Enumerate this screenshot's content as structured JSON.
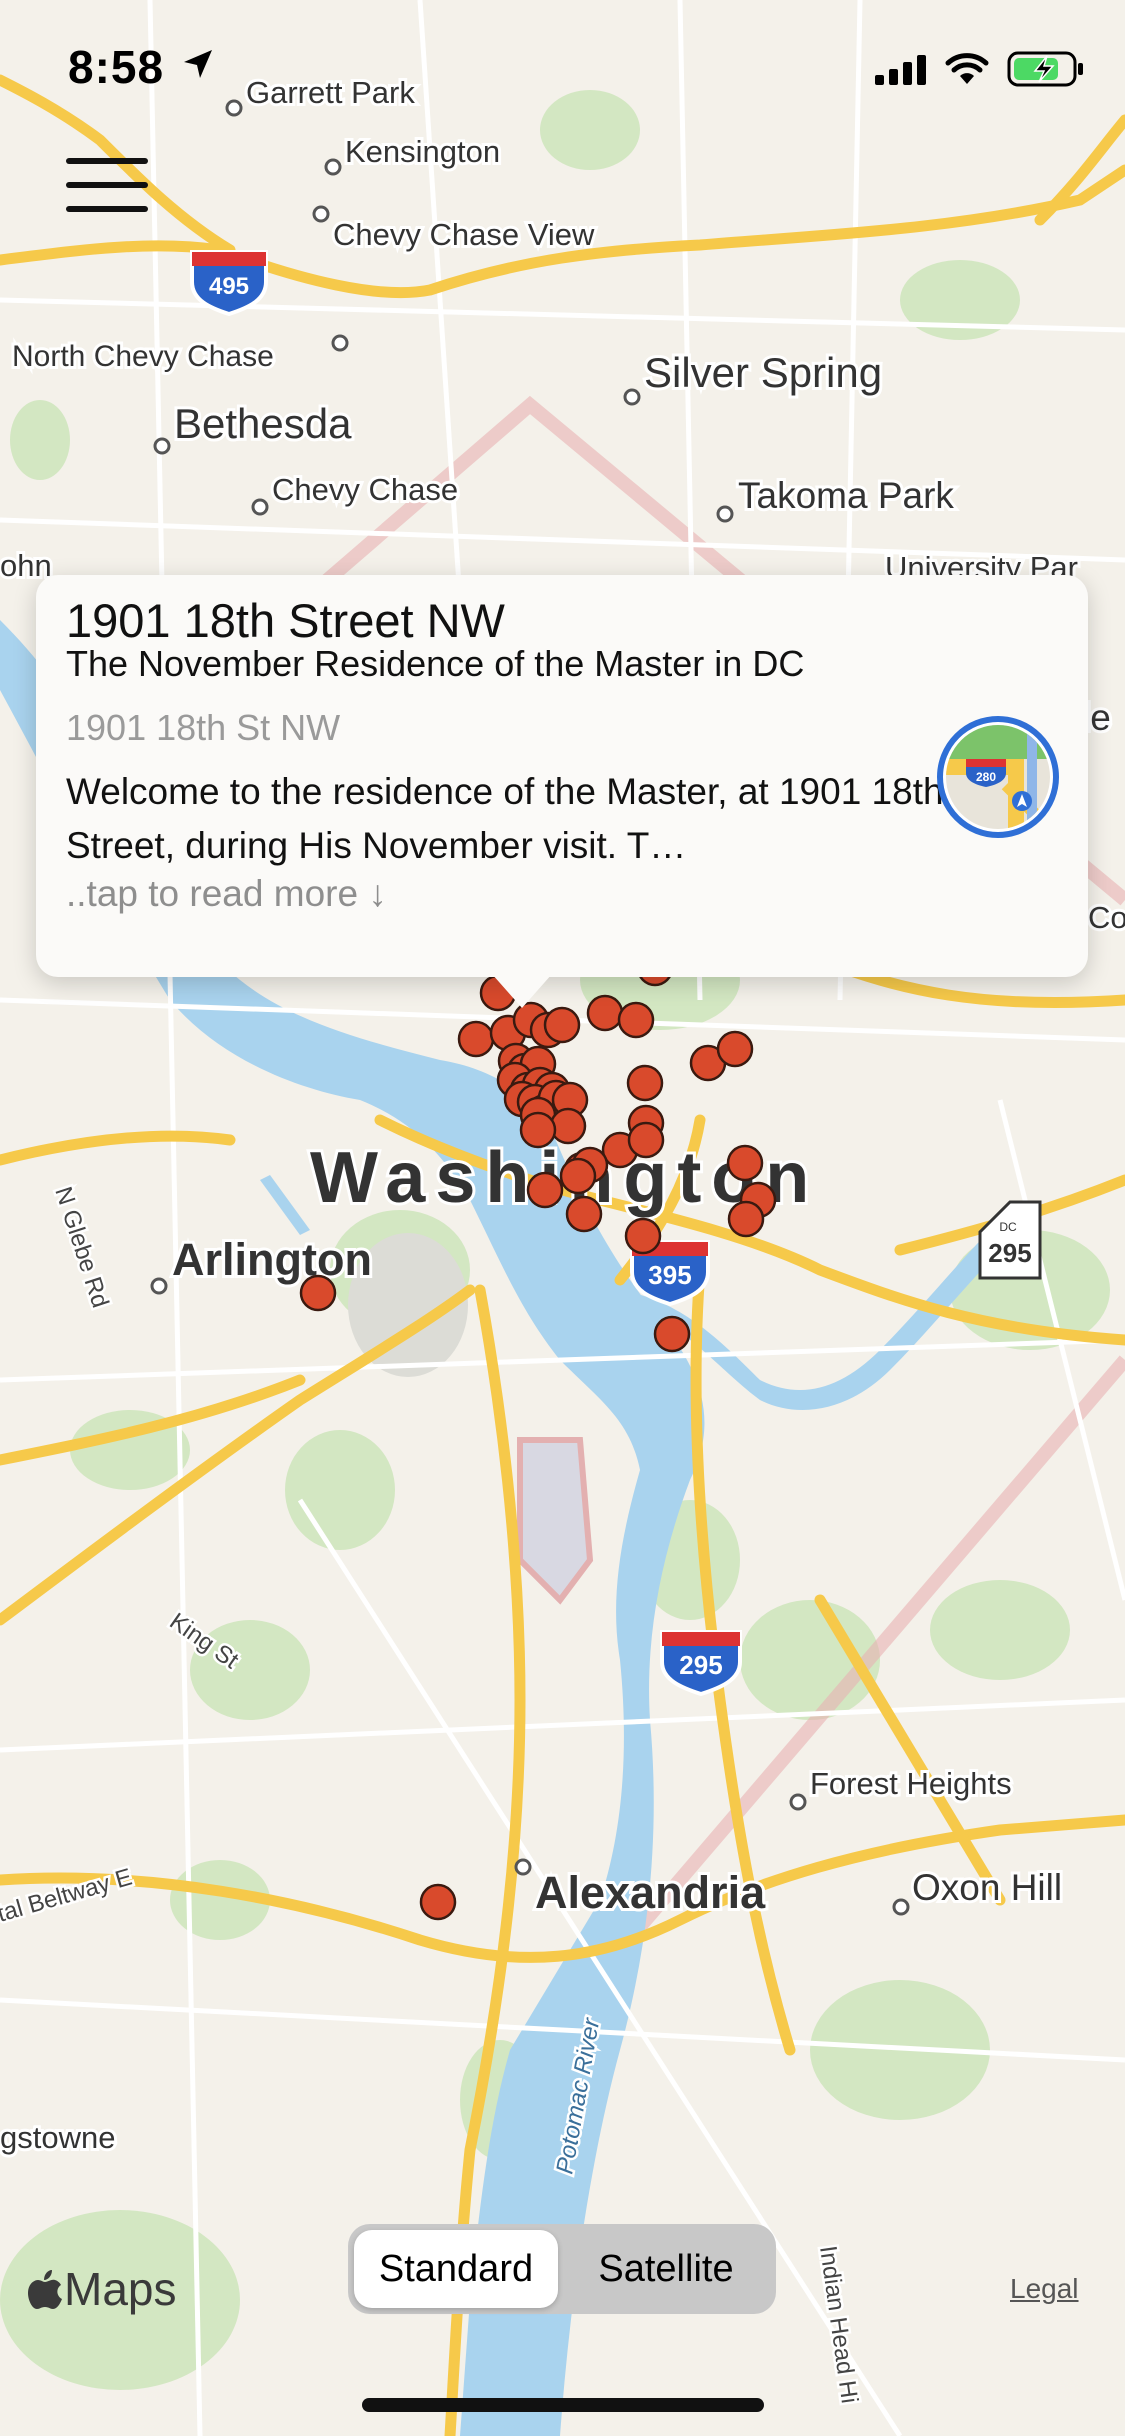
{
  "status": {
    "time": "8:58"
  },
  "map": {
    "places": [
      "Garrett Park",
      "Kensington",
      "Chevy Chase View",
      "North Chevy Chase",
      "Silver Spring",
      "Bethesda",
      "Chevy Chase",
      "Takoma Park",
      "University Par",
      "ohn",
      "le",
      "Co",
      "Washington",
      "Arlington",
      "Forest Heights",
      "Alexandria",
      "Oxon Hill",
      "gstowne"
    ],
    "roads": [
      "N Glebe Rd",
      "King St",
      "tal Beltway E",
      "Potomac River",
      "Indian Head Hi"
    ],
    "shields": {
      "i495_north": "495",
      "i395": "395",
      "i295": "295",
      "dc295": "295",
      "dc_label": "DC"
    }
  },
  "callout": {
    "title": "1901 18th Street NW",
    "subtitle": "The November Residence of the Master in DC",
    "address": "1901 18th St NW",
    "description": "Welcome to the residence of the Master, at 1901 18th Street, during His November visit. T…",
    "more": "..tap to read more ↓",
    "map_icon_shield": "280"
  },
  "footer": {
    "maps_label": "Maps",
    "legal": "Legal",
    "segments": [
      "Standard",
      "Satellite"
    ],
    "selected_segment": "Standard"
  },
  "colors": {
    "marker": "#d94a2c",
    "water": "#a9d3ee",
    "highway": "#f6c94a",
    "park": "#cfe5bd",
    "land": "#f4f1ea"
  },
  "icons": [
    "location-arrow-icon",
    "signal-icon",
    "wifi-icon",
    "battery-icon",
    "menu-icon",
    "maps-app-icon",
    "apple-logo-icon"
  ]
}
